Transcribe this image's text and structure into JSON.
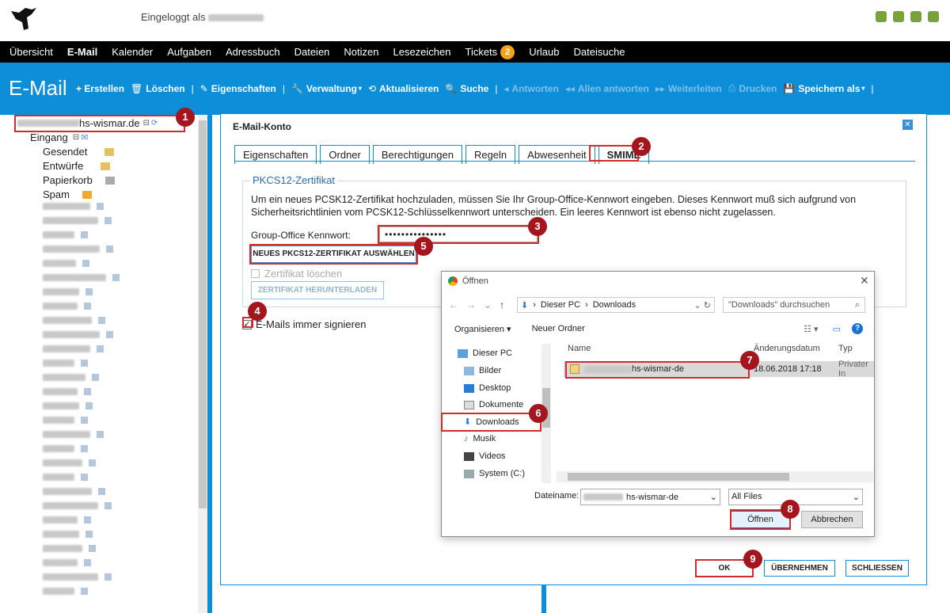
{
  "header": {
    "logged_in_label": "Eingeloggt als"
  },
  "menu": {
    "items": [
      "Übersicht",
      "E-Mail",
      "Kalender",
      "Aufgaben",
      "Adressbuch",
      "Dateien",
      "Notizen",
      "Lesezeichen",
      "Tickets",
      "Urlaub",
      "Dateisuche"
    ],
    "active": "E-Mail",
    "tickets_badge": "2"
  },
  "toolbar": {
    "title": "E-Mail",
    "create": "+ Erstellen",
    "delete": "Löschen",
    "properties": "Eigenschaften",
    "admin": "Verwaltung",
    "refresh": "Aktualisieren",
    "search": "Suche",
    "reply": "Antworten",
    "reply_all": "Allen antworten",
    "forward": "Weiterleiten",
    "print": "Drucken",
    "save_as": "Speichern als"
  },
  "tree": {
    "account": "hs-wismar.de",
    "inbox": "Eingang",
    "folders": [
      "Gesendet",
      "Entwürfe",
      "Papierkorb",
      "Spam"
    ]
  },
  "dialog": {
    "title": "E-Mail-Konto",
    "close_icon": "close-icon",
    "tabs": [
      "Eigenschaften",
      "Ordner",
      "Berechtigungen",
      "Regeln",
      "Abwesenheit",
      "SMIME"
    ],
    "selected_tab": "SMIME",
    "legend": "PKCS12-Zertifikat",
    "description": "Um ein neues PCSK12-Zertifikat hochzuladen, müssen Sie Ihr Group-Office-Kennwort eingeben. Dieses Kennwort muß sich aufgrund von Sicherheitsrichtlinien vom PCSK12-Schlüsselkennwort unterscheiden. Ein leeres Kennwort ist ebenso nicht zugelassen.",
    "password_label": "Group-Office Kennwort:",
    "password_value": "•••••••••••••••",
    "new_cert_button": "NEUES PKCS12-ZERTIFIKAT AUSWÄHLEN",
    "delete_cert_label": "Zertifikat löschen",
    "download_cert_button": "ZERTIFIKAT HERUNTERLADEN",
    "always_sign_label": "E-Mails immer signieren",
    "ok_button": "OK",
    "apply_button": "ÜBERNEHMEN",
    "close_button": "SCHLIESSEN"
  },
  "file_dialog": {
    "title": "Öffnen",
    "address": [
      "Dieser PC",
      "Downloads"
    ],
    "search_placeholder": "\"Downloads\" durchsuchen",
    "organize": "Organisieren",
    "new_folder": "Neuer Ordner",
    "nav_items": [
      "Dieser PC",
      "Bilder",
      "Desktop",
      "Dokumente",
      "Downloads",
      "Musik",
      "Videos",
      "System (C:)"
    ],
    "selected_nav": "Downloads",
    "columns": [
      "Name",
      "Änderungsdatum",
      "Typ"
    ],
    "file": {
      "name": "hs-wismar-de",
      "date": "18.06.2018 17:18",
      "type": "Privater In"
    },
    "filename_label": "Dateiname:",
    "filename_value": "hs-wismar-de",
    "filetype": "All Files",
    "open_button": "Öffnen",
    "cancel_button": "Abbrechen"
  },
  "steps": [
    "1",
    "2",
    "3",
    "4",
    "5",
    "6",
    "7",
    "8",
    "9"
  ],
  "colors": {
    "accent": "#0d8ed8",
    "highlight": "#d42a2a",
    "step_badge": "#a3161e",
    "badge": "#f5a21b"
  }
}
